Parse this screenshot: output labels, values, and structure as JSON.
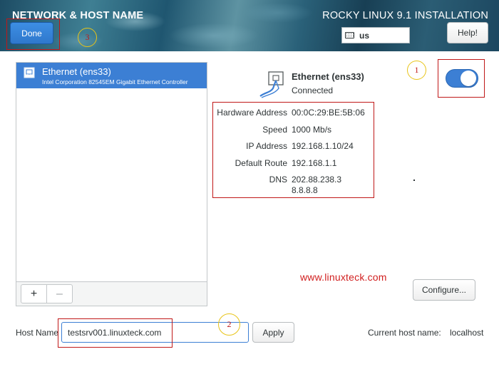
{
  "header": {
    "page_title": "NETWORK & HOST NAME",
    "install_title": "ROCKY LINUX 9.1 INSTALLATION",
    "done_label": "Done",
    "keyboard_layout": "us",
    "help_label": "Help!"
  },
  "device_list": {
    "items": [
      {
        "name": "Ethernet (ens33)",
        "description": "Intel Corporation 82545EM Gigabit Ethernet Controller"
      }
    ],
    "add_label": "+",
    "remove_label": "–"
  },
  "device_detail": {
    "name": "Ethernet (ens33)",
    "status": "Connected",
    "enabled": true,
    "rows": [
      {
        "label": "Hardware Address",
        "value": "00:0C:29:BE:5B:06"
      },
      {
        "label": "Speed",
        "value": "1000 Mb/s"
      },
      {
        "label": "IP Address",
        "value": "192.168.1.10/24"
      },
      {
        "label": "Default Route",
        "value": "192.168.1.1"
      },
      {
        "label": "DNS",
        "value": "202.88.238.3",
        "value2": "8.8.8.8"
      }
    ],
    "configure_label": "Configure..."
  },
  "watermark": "www.linuxteck.com",
  "hostname": {
    "label": "Host Name",
    "value": "testsrv001.linuxteck.com",
    "apply_label": "Apply",
    "current_label": "Current host name:",
    "current_value": "localhost"
  },
  "annotations": {
    "marker_1": "1",
    "marker_2": "2",
    "marker_3": "3",
    "color_rect": "#c01818",
    "color_circle": "#e8c417"
  },
  "colors": {
    "accent": "#3c7fd4",
    "text": "#2e3436"
  },
  "icons": {
    "keyboard": "keyboard-icon",
    "ethernet": "ethernet-icon",
    "ethernet_small": "ethernet-small-icon"
  }
}
